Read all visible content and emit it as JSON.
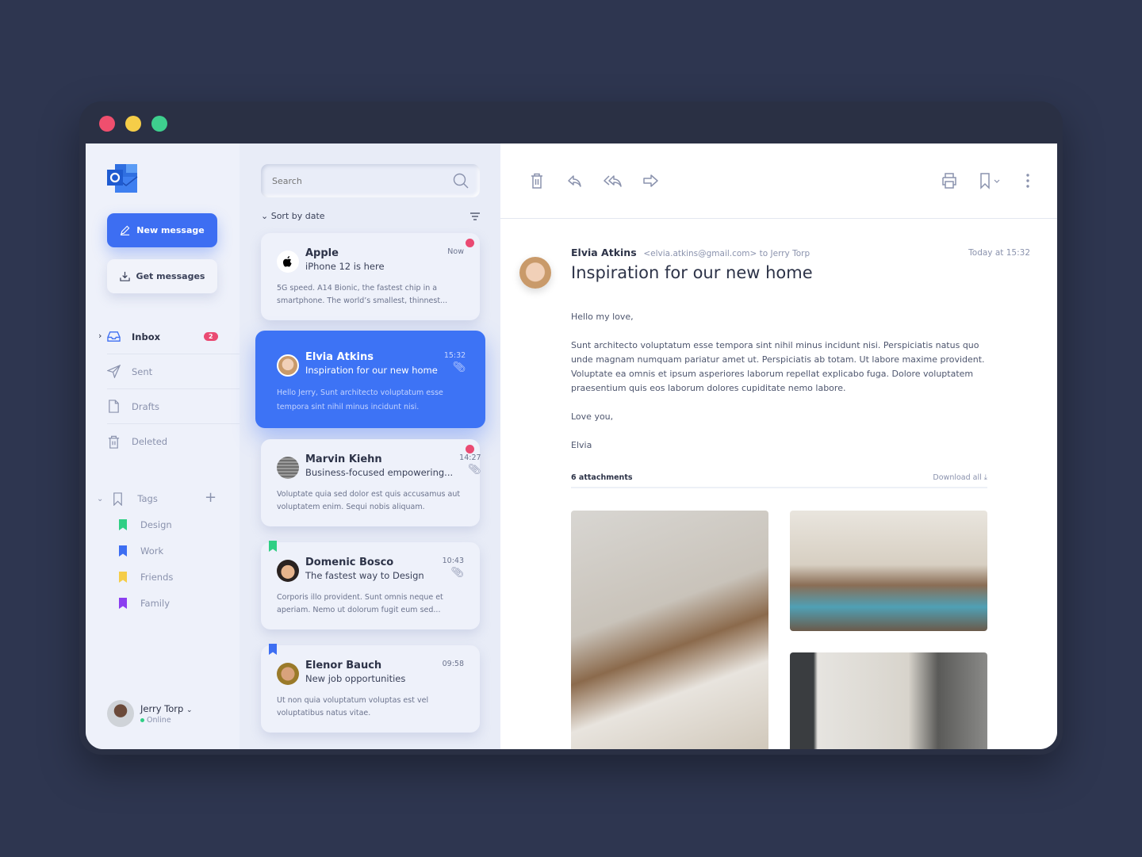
{
  "window": {
    "controls": [
      {
        "name": "close",
        "color": "#ef4f6e"
      },
      {
        "name": "minimize",
        "color": "#f5cd48"
      },
      {
        "name": "maximize",
        "color": "#3ecf8e"
      }
    ]
  },
  "sidebar": {
    "new_message": "New message",
    "get_messages": "Get messages",
    "folders": [
      {
        "label": "Inbox",
        "icon": "inbox-icon",
        "badge": "2",
        "active": true
      },
      {
        "label": "Sent",
        "icon": "send-icon"
      },
      {
        "label": "Drafts",
        "icon": "file-icon"
      },
      {
        "label": "Deleted",
        "icon": "trash-icon"
      }
    ],
    "tags_label": "Tags",
    "tags": [
      {
        "label": "Design",
        "color": "#2fcf84"
      },
      {
        "label": "Work",
        "color": "#3d6ef2"
      },
      {
        "label": "Friends",
        "color": "#f5cd48"
      },
      {
        "label": "Family",
        "color": "#8b3ef0"
      }
    ],
    "user": {
      "name": "Jerry Torp",
      "status": "Online",
      "status_color": "#2fcf84"
    }
  },
  "list": {
    "search_placeholder": "Search",
    "sort_label": "Sort by date",
    "messages": [
      {
        "sender": "Apple",
        "subject": "iPhone 12 is here",
        "time": "Now",
        "preview": "5G speed. A14 Bionic, the fastest chip in a smartphone. The world’s smallest, thinnest...",
        "unread": true,
        "attachment": false
      },
      {
        "sender": "Elvia Atkins",
        "subject": "Inspiration for our new home",
        "time": "15:32",
        "preview": "Hello Jerry, Sunt architecto voluptatum esse tempora sint nihil minus incidunt nisi.",
        "selected": true,
        "attachment": true
      },
      {
        "sender": "Marvin Kiehn",
        "subject": "Business-focused empowering...",
        "time": "14:27",
        "preview": "Voluptate quia sed dolor est quis accusamus aut voluptatem enim. Sequi nobis aliquam.",
        "unread": true,
        "attachment": true
      },
      {
        "sender": "Domenic Bosco",
        "subject": "The fastest way to Design",
        "time": "10:43",
        "preview": "Corporis illo provident. Sunt omnis neque et aperiam. Nemo ut dolorum fugit eum sed...",
        "tag": "Design",
        "attachment": true
      },
      {
        "sender": "Elenor Bauch",
        "subject": "New job opportunities",
        "time": "09:58",
        "preview": "Ut non quia voluptatum voluptas est vel voluptatibus natus vitae.",
        "tag": "Work",
        "attachment": false
      }
    ]
  },
  "reader": {
    "toolbar": [
      "trash-icon",
      "reply-icon",
      "reply-all-icon",
      "forward-icon",
      "print-icon",
      "bookmark-icon",
      "more-icon"
    ],
    "from_name": "Elvia Atkins",
    "from_meta": "<elvia.atkins@gmail.com> to Jerry Torp",
    "date": "Today at 15:32",
    "subject": "Inspiration for our new home",
    "body": [
      "Hello my love,",
      "Sunt architecto voluptatum esse tempora sint nihil minus incidunt nisi. Perspiciatis natus quo unde magnam numquam pariatur amet ut. Perspiciatis ab totam. Ut labore maxime provident. Voluptate ea omnis et ipsum asperiores laborum repellat explicabo fuga. Dolore voluptatem praesentium quis eos laborum dolores cupiditate nemo labore.",
      "Love you,",
      "Elvia"
    ],
    "attachments_label": "6 attachments",
    "download_all": "Download all"
  }
}
